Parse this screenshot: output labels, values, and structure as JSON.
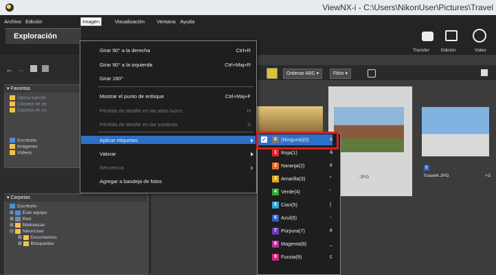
{
  "window": {
    "title": "ViewNX-i - C:\\Users\\NikonUser\\Pictures\\Travel"
  },
  "menubar": {
    "items": [
      "Archivo",
      "Edición",
      "Imagen",
      "Visualización",
      "Ventana",
      "Ayuda"
    ]
  },
  "tab": {
    "label": "Exploración"
  },
  "toolbar_right": {
    "transfer": "Transfer",
    "edicion": "Edición",
    "video": "Video"
  },
  "imagen_menu": {
    "items": [
      {
        "label": "Girar 90° a la derecha",
        "shortcut": "Ctrl+R"
      },
      {
        "label": "Girar 90° a la izquierda",
        "shortcut": "Ctrl+Maj+R"
      },
      {
        "label": "Girar 180°",
        "shortcut": ""
      },
      {
        "label": "Mostrar el punto de enfoque",
        "shortcut": "Ctrl+Maj+F"
      },
      {
        "label": "Pérdida de detalle en las altas luces",
        "shortcut": "H"
      },
      {
        "label": "Pérdida de detalle en las sombras",
        "shortcut": "S"
      },
      {
        "label": "Aplicar etiquetas",
        "shortcut": ""
      },
      {
        "label": "Valorar",
        "shortcut": ""
      },
      {
        "label": "Secuencia",
        "shortcut": ""
      },
      {
        "label": "Agregar a bandeja de fotos",
        "shortcut": ""
      }
    ]
  },
  "labels_submenu": {
    "items": [
      {
        "num": "0",
        "label": "(Ninguna)(0)",
        "key": "à",
        "color": "#7a7a7a"
      },
      {
        "num": "1",
        "label": "Roja(1)",
        "key": "&",
        "color": "#d9262c"
      },
      {
        "num": "2",
        "label": "Naranja(2)",
        "key": "é",
        "color": "#e96a1f"
      },
      {
        "num": "3",
        "label": "Amarilla(3)",
        "key": "\"",
        "color": "#e3a51c"
      },
      {
        "num": "4",
        "label": "Verde(4)",
        "key": "'",
        "color": "#3aa53a"
      },
      {
        "num": "5",
        "label": "Cian(5)",
        "key": "(",
        "color": "#2fa5d8"
      },
      {
        "num": "6",
        "label": "Azul(6)",
        "key": "-",
        "color": "#2f5fc8"
      },
      {
        "num": "7",
        "label": "Púrpura(7)",
        "key": "è",
        "color": "#6a3fb8"
      },
      {
        "num": "8",
        "label": "Magenta(8)",
        "key": "_",
        "color": "#c22aa0"
      },
      {
        "num": "9",
        "label": "Fucsia(9)",
        "key": "ç",
        "color": "#d8267a"
      }
    ]
  },
  "favoritas": {
    "header": "Favoritas",
    "items": [
      "Última transfe",
      "Carpeta de de",
      "Carpeta de co"
    ],
    "locations": [
      "Escritorio",
      "Imágenes",
      "Vídeos"
    ]
  },
  "carpetas": {
    "header": "Carpetas",
    "items": [
      "Escritorio",
      "Este equipo",
      "Red",
      "Bibliotecas",
      "NikonUser",
      "Documentos",
      "Búsquedas"
    ]
  },
  "content_toolbar": {
    "sort": "Ordenar ABC",
    "filter": "Filtro"
  },
  "thumbnails": [
    {
      "name": ".JPG"
    },
    {
      "name": "Travel4.JPG",
      "rating_badge": "6",
      "extra": "+3"
    }
  ],
  "colors": {
    "accent": "#2d70c8",
    "highlight_outline": "#e01e1e"
  }
}
